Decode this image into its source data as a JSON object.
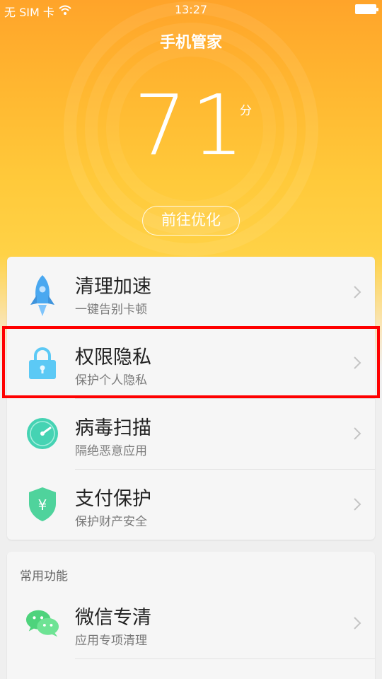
{
  "status_bar": {
    "carrier": "无 SIM 卡",
    "time": "13:27",
    "wifi_icon": "wifi-icon",
    "battery_icon": "battery-icon"
  },
  "header": {
    "title": "手机管家",
    "score": "71",
    "score_unit": "分",
    "optimize_label": "前往优化"
  },
  "main_items": [
    {
      "title": "清理加速",
      "subtitle": "一键告别卡顿",
      "icon": "rocket-icon"
    },
    {
      "title": "权限隐私",
      "subtitle": "保护个人隐私",
      "icon": "lock-icon"
    },
    {
      "title": "病毒扫描",
      "subtitle": "隔绝恶意应用",
      "icon": "scan-clock-icon"
    },
    {
      "title": "支付保护",
      "subtitle": "保护财产安全",
      "icon": "yuan-shield-icon"
    }
  ],
  "common": {
    "header": "常用功能",
    "items": [
      {
        "title": "微信专清",
        "subtitle": "应用专项清理",
        "icon": "wechat-icon"
      }
    ]
  },
  "colors": {
    "accent": "#ffb630",
    "highlight": "#ff0000"
  }
}
